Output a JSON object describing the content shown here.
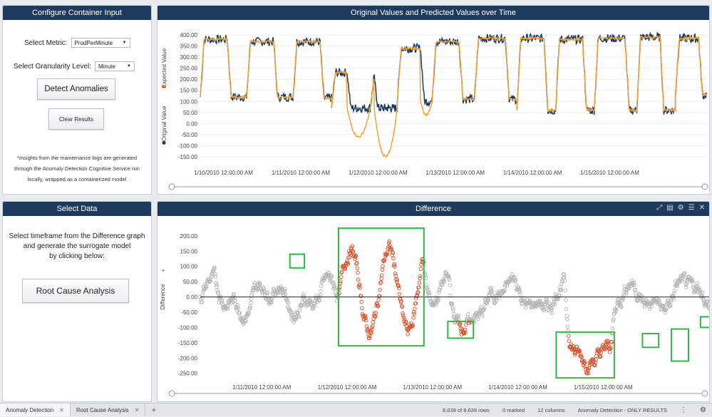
{
  "config_panel": {
    "title": "Configure Container Input",
    "metric_label": "Select Metric:",
    "metric_value": "ProdPerMinute",
    "granularity_label": "Select Granularity Level:",
    "granularity_value": "Minute",
    "detect_button": "Detect Anomalies",
    "clear_button": "Clear Results",
    "note_lines": [
      "*Insights from the maintenance logs are generated",
      "through the Anomaly Detection Cognitive Service run",
      "locally, wrapped as a containerized model"
    ]
  },
  "select_panel": {
    "title": "Select Data",
    "instruction_lines": [
      "Select timeframe from the Difference graph",
      "and generate the surrogate model",
      "by clicking below:"
    ],
    "rca_button": "Root Cause Analysis"
  },
  "top_chart_panel": {
    "title": "Original Values and Predicted Values over Time"
  },
  "diff_chart_panel": {
    "title": "Difference"
  },
  "colors": {
    "header": "#1e3a5c",
    "original": "#1c3a5e",
    "expected": "#f0a43a",
    "normal_point": "#b4b4b4",
    "anomaly_point": "#d9502a",
    "highlight_box": "#2fb54a"
  },
  "chart_data": [
    {
      "type": "line",
      "title": "",
      "ylabel_series": [
        "Expected Value",
        "Original Value"
      ],
      "series": [
        {
          "name": "Expected Value",
          "color": "#f0a43a"
        },
        {
          "name": "Original Value",
          "color": "#1c3a5e"
        }
      ],
      "y_ticks": [
        "400.00",
        "350.00",
        "300.00",
        "250.00",
        "200.00",
        "150.00",
        "100.00",
        "50.00",
        "0.00",
        "-50.00",
        "-100.00",
        "-150.00"
      ],
      "ylim": [
        -160,
        410
      ],
      "x_ticks": [
        "1/10/2010 12:00:00 AM",
        "1/11/2010 12:00:00 AM",
        "1/12/2010 12:00:00 AM",
        "1/13/2010 12:00:00 AM",
        "1/14/2010 12:00:00 AM",
        "1/15/2010 12:00:00 AM"
      ],
      "x_range_days": [
        0.2,
        6.75
      ],
      "cycles": [
        {
          "start": 0.2,
          "low_start": 0.55,
          "low_end": 0.8,
          "high": 380,
          "low": 120
        },
        {
          "start": 0.8,
          "low_start": 1.15,
          "low_end": 1.4,
          "high": 370,
          "low": 120
        },
        {
          "start": 1.4,
          "low_start": 1.75,
          "low_end": 1.9,
          "high": 370,
          "low": 115
        },
        {
          "start": 1.9,
          "low_start": 2.1,
          "low_end": 2.4,
          "high": 230,
          "low": 70,
          "exp_low": -60
        },
        {
          "start": 2.4,
          "low_start": 2.45,
          "low_end": 2.75,
          "high": 210,
          "low": 70,
          "exp_low": -150
        },
        {
          "start": 2.75,
          "low_start": 3.05,
          "low_end": 3.2,
          "high": 340,
          "low": 100,
          "exp_low": 40
        },
        {
          "start": 3.2,
          "low_start": 3.55,
          "low_end": 3.75,
          "high": 370,
          "low": 110
        },
        {
          "start": 3.75,
          "low_start": 4.15,
          "low_end": 4.3,
          "high": 385,
          "low": 110
        },
        {
          "start": 4.3,
          "low_start": 4.65,
          "low_end": 4.8,
          "high": 385,
          "low": 60
        },
        {
          "start": 4.8,
          "low_start": 5.15,
          "low_end": 5.3,
          "high": 380,
          "low": 60
        },
        {
          "start": 5.3,
          "low_start": 5.7,
          "low_end": 5.85,
          "high": 385,
          "low": 60
        },
        {
          "start": 5.85,
          "low_start": 6.15,
          "low_end": 6.35,
          "high": 390,
          "low": 60
        },
        {
          "start": 6.35,
          "low_start": 6.65,
          "low_end": 6.75,
          "high": 385,
          "low": 130
        }
      ]
    },
    {
      "type": "scatter",
      "title": "",
      "ylabel": "Difference",
      "y_ticks": [
        "200.00",
        "150.00",
        "100.00",
        "50.00",
        "0.00",
        "-50.00",
        "-100.00",
        "-150.00",
        "-200.00",
        "-250.00"
      ],
      "ylim": [
        -260,
        230
      ],
      "x_ticks": [
        "1/11/2010 12:00:00 AM",
        "1/12/2010 12:00:00 AM",
        "1/13/2010 12:00:00 AM",
        "1/14/2010 12:00:00 AM",
        "1/15/2010 12:00:00 AM"
      ],
      "x_range_days": [
        0.78,
        6.75
      ],
      "anomaly_regions": [
        {
          "x0": 1.83,
          "x1": 2.0,
          "y0": 140,
          "y1": 95
        },
        {
          "x0": 2.4,
          "x1": 3.4,
          "y0": 225,
          "y1": -160
        },
        {
          "x0": 3.68,
          "x1": 3.98,
          "y0": -80,
          "y1": -135
        },
        {
          "x0": 4.95,
          "x1": 5.63,
          "y0": -115,
          "y1": -265
        },
        {
          "x0": 5.96,
          "x1": 6.15,
          "y0": -120,
          "y1": -165
        },
        {
          "x0": 6.3,
          "x1": 6.5,
          "y0": -105,
          "y1": -210
        },
        {
          "x0": 6.64,
          "x1": 6.8,
          "y0": -65,
          "y1": -100
        }
      ]
    }
  ],
  "tabs": [
    {
      "label": "Anomaly Detection",
      "active": true
    },
    {
      "label": "Root Cause Analysis",
      "active": false
    }
  ],
  "status_bar": {
    "rows": "8,639 of 8,639 rows",
    "marked": "0 marked",
    "columns": "12 columns",
    "page": "Anomaly Detection - ONLY RESULTS"
  }
}
